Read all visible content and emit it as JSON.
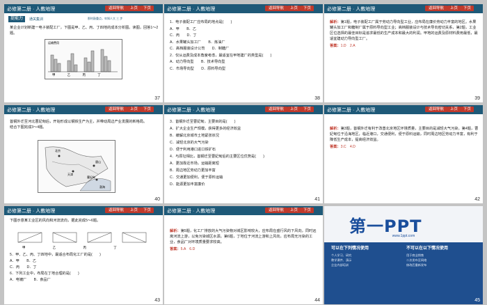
{
  "header": {
    "title": "必修第二册 · 人教地理",
    "nav_label": "返回导航",
    "prev_label": "上页",
    "next_label": "下页"
  },
  "slides": {
    "s37": {
      "page": "37",
      "section_title": "提能力",
      "section_sub": "通关集训",
      "tagline": "那时敲重点，牢知人大 三 步",
      "question": "某企业计划新建一电子装配工厂，下图是甲、乙、丙、丁四地的成本分析图。读图，回答1～2题。",
      "legend": "运输费用",
      "chart_labels": [
        "甲",
        "乙",
        "丙",
        "丁"
      ]
    },
    "s38": {
      "page": "38",
      "lines": [
        "1．电子装配工厂应布局的地点是(　　)",
        "A．甲　　B．乙",
        "C．丙　　D．丁",
        "2．下列工业与电子装配工厂区位选择一致的是(　　)",
        "A．水果罐头加工厂　　B．炼油厂",
        "C．高档服装设计公司　　D．制糖厂",
        "2．仅从运费及成本角度考虑，最适宜在甲地建厂的类型是(　　)",
        "A．动力导向型　　B．技术导向型",
        "C．市场导向型　　D．原料导向型"
      ]
    },
    "s39": {
      "page": "39",
      "label": "解析：",
      "text": "第1题，电子装配工厂属于劳动力导向型工业，应布局在廉价劳动力丰富的地区。水果罐头加工厂和糖制厂属于原料导向型工业；高档服装设计与技术导向密切关系，第2题，工业区位选择的最佳目标是追求最低的生产成本和最大的利润。甲地的运费及原材料费用最低，最适宜建动力导向型工厂。",
      "answer_label": "答案：",
      "answer": "1.D　2.A"
    },
    "s40": {
      "page": "40",
      "intro": "首钢外迁至河北曹妃甸后，开始形成以钢铁生产为主，并带动周边产业发展的新格局。",
      "question": "结合下图完成3～4题。",
      "map_labels": [
        "北京",
        "天津",
        "唐山",
        "曹妃甸",
        "渤海"
      ]
    },
    "s41": {
      "page": "41",
      "lines": [
        "3．首钢外迁至曹妃甸，主要目的是(　　)",
        "A．扩大企业生产规模，获得更多的经济效益",
        "B．缓解北京城市土地紧张状况",
        "C．减轻北京的大气污染",
        "D．便于利用港口进口铁矿石",
        "4．与原址相比，首钢迁至曹妃甸后的主要区位优势是(　　)",
        "A．更加靠近市场，运输距离短",
        "B．周边地区劳动力更加丰富",
        "C．交通更加便利，便于原料运输",
        "D．能源更加丰富廉价"
      ]
    },
    "s42": {
      "page": "42",
      "label": "解析：",
      "text": "第3题，首钢外迁有利于改善北京地区环境质量，主要目的是减轻大气污染。第4题，曹妃甸位于沿海地区，临近港口，交通便利，便于原料运输，同时周边地区劳动力丰富，有利于降低生产成本，提高经济效益。",
      "answer_label": "答案：",
      "answer": "3.C　4.D"
    },
    "s43": {
      "page": "43",
      "intro": "下图示意某工业区的风向和河流流向，据此完成5～6题。",
      "options": [
        "甲",
        "乙",
        "丙",
        "丁"
      ],
      "lines": [
        "5．甲、乙、丙、丁四地中，最适合布局化工厂的是(　　)",
        "A．甲　　B．乙",
        "C．丙　　D．丁",
        "6．下列工业中，布局在丁地合理的是(　　)",
        "A．电镀厂　　B．食品厂"
      ]
    },
    "s44": {
      "page": "44",
      "label": "解析：",
      "text": "第5题，化工厂排放的大气污染物对城区影响较大，应布局在盛行风的下风向，同时远离河流上游，以免污染城区水源。第6题，丁地位于河流上游和上风向，应布局无污染的工业，食品厂对环境质量要求较高。",
      "answer_label": "答案：",
      "answer": "5.A　6.D"
    },
    "s45": {
      "page": "45",
      "logo": "第一PPT",
      "url": "www.1ppt.com",
      "col1_title": "可以在下列情况使用",
      "col2_title": "不可以在以下情况使用",
      "col1_lines": [
        "个人学习、研究",
        "教学课件、演示",
        "企业内部培训"
      ],
      "col2_lines": [
        "用于商业销售",
        "二次发布至网络",
        "修改后重新发布"
      ]
    }
  }
}
